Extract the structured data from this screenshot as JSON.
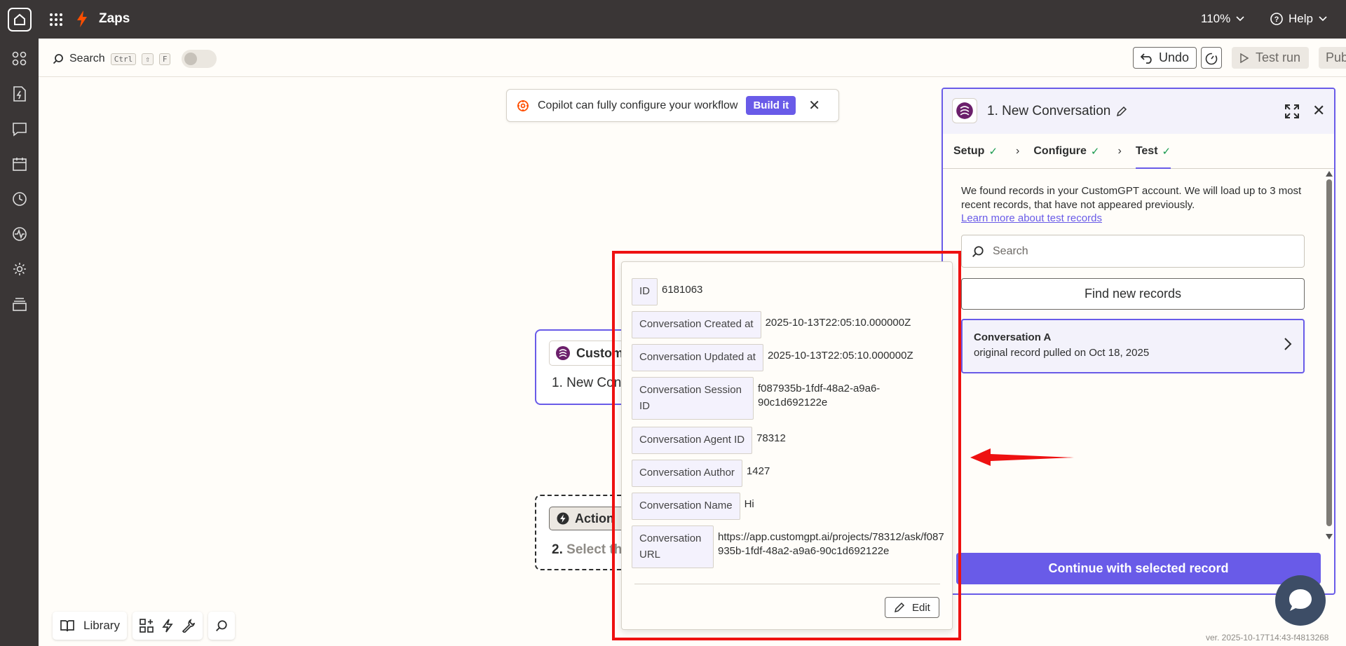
{
  "app": {
    "title": "Zaps",
    "zoom": "110%",
    "help": "Help"
  },
  "toolbar": {
    "search_label": "Search",
    "shortcut_keys": [
      "Ctrl",
      "⇧",
      "F"
    ],
    "undo_label": "Undo",
    "test_run_label": "Test run",
    "publish_label": "Publish"
  },
  "copilot": {
    "message": "Copilot can fully configure your workflow",
    "build_label": "Build it"
  },
  "canvas": {
    "trigger": {
      "app_name": "Custom",
      "step": "1. New Con"
    },
    "action": {
      "tag": "Action",
      "step_num": "2.",
      "step_text": "Select th"
    }
  },
  "record_detail": {
    "fields": [
      {
        "key": "ID",
        "value": "6181063"
      },
      {
        "key": "Conversation Created at",
        "value": "2025-10-13T22:05:10.000000Z"
      },
      {
        "key": "Conversation Updated at",
        "value": "2025-10-13T22:05:10.000000Z"
      },
      {
        "key": "Conversation Session ID",
        "value": "f087935b-1fdf-48a2-a9a6-90c1d692122e"
      },
      {
        "key": "Conversation Agent ID",
        "value": "78312"
      },
      {
        "key": "Conversation Author",
        "value": "1427"
      },
      {
        "key": "Conversation Name",
        "value": "Hi"
      },
      {
        "key": "Conversation URL",
        "value": "https://app.customgpt.ai/projects/78312/ask/f087935b-1fdf-48a2-a9a6-90c1d692122e"
      }
    ],
    "edit_label": "Edit"
  },
  "panel": {
    "title": "1. New Conversation",
    "tabs": [
      {
        "label": "Setup"
      },
      {
        "label": "Configure"
      },
      {
        "label": "Test"
      }
    ],
    "info_text": "We found records in your CustomGPT account. We will load up to 3 most recent records, that have not appeared previously.",
    "learn_more": "Learn more about test records",
    "search_placeholder": "Search",
    "find_label": "Find new records",
    "record": {
      "title": "Conversation A",
      "subtitle": "original record pulled on Oct 18, 2025"
    },
    "continue_label": "Continue with selected record"
  },
  "bottom_toolbar": {
    "library_label": "Library"
  },
  "version": "ver. 2025-10-17T14:43-f4813268",
  "colors": {
    "accent": "#695be8",
    "topbar": "#3a3636",
    "highlight_red": "#ee1111",
    "success": "#1a9a4f"
  }
}
